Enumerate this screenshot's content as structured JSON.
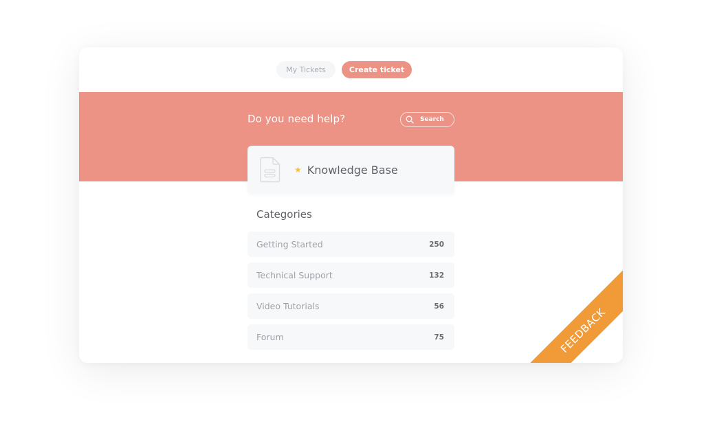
{
  "tabs": {
    "my_tickets": "My Tickets",
    "create_ticket": "Create ticket"
  },
  "banner": {
    "title": "Do you need help?",
    "search_label": "Search",
    "search_icon": "search-icon"
  },
  "knowledge_base": {
    "title": "Knowledge Base",
    "icon": "document-icon",
    "badge_icon": "star-icon"
  },
  "categories": {
    "heading": "Categories",
    "items": [
      {
        "name": "Getting Started",
        "count": "250"
      },
      {
        "name": "Technical Support",
        "count": "132"
      },
      {
        "name": "Video Tutorials",
        "count": "56"
      },
      {
        "name": "Forum",
        "count": "75"
      }
    ]
  },
  "feedback": {
    "label": "FEEDBACK"
  },
  "colors": {
    "accent": "#ec9385",
    "feedback": "#f09a38",
    "star": "#f3c33b",
    "surface": "#f7f8fa"
  }
}
